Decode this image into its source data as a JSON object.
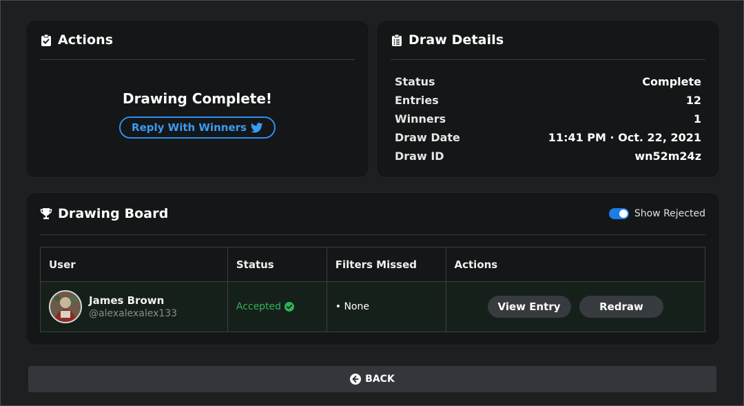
{
  "actions": {
    "title": "Actions",
    "message": "Drawing Complete!",
    "reply_label": "Reply With Winners"
  },
  "details": {
    "title": "Draw Details",
    "rows": [
      {
        "label": "Status",
        "value": "Complete"
      },
      {
        "label": "Entries",
        "value": "12"
      },
      {
        "label": "Winners",
        "value": "1"
      },
      {
        "label": "Draw Date",
        "value": "11:41 PM · Oct. 22, 2021"
      },
      {
        "label": "Draw ID",
        "value": "wn52m24z"
      }
    ]
  },
  "board": {
    "title": "Drawing Board",
    "toggle_label": "Show Rejected",
    "toggle_on": true,
    "columns": [
      "User",
      "Status",
      "Filters Missed",
      "Actions"
    ],
    "rows": [
      {
        "name": "James Brown",
        "handle": "@alexalexalex133",
        "status": "Accepted",
        "filters_missed": "• None",
        "view_label": "View Entry",
        "redraw_label": "Redraw"
      }
    ]
  },
  "back_label": "BACK",
  "colors": {
    "accent": "#2b8ff0",
    "accepted": "#2fb25a",
    "card": "#151617",
    "background": "#1e1f21"
  },
  "icons": {
    "actions": "clipboard-check-icon",
    "details": "clipboard-list-icon",
    "board": "trophy-icon",
    "reply": "twitter-icon",
    "status": "check-circle-icon",
    "back": "arrow-left-circle-icon"
  }
}
